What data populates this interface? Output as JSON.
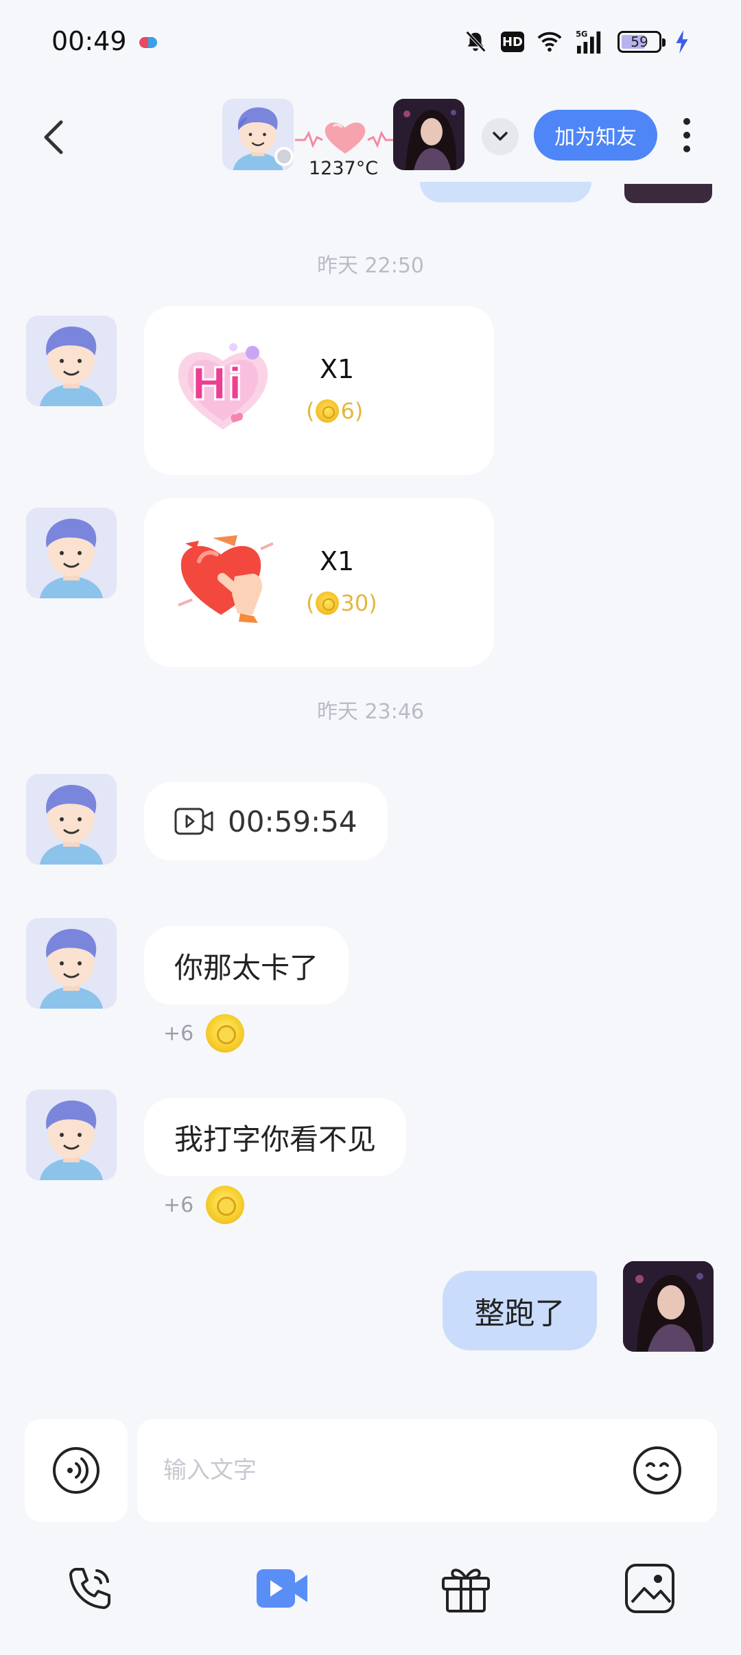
{
  "status_bar": {
    "time": "00:49",
    "battery": "59",
    "network": "5G",
    "hd_badge": "HD"
  },
  "header": {
    "intimacy_temperature": "1237°C",
    "add_friend_label": "加为知友"
  },
  "messages": {
    "timestamp_1": "昨天 22:50",
    "gift_1": {
      "count": "X1",
      "price_open": "(",
      "price_value": "6)",
      "gift": "hi-heart-sticker"
    },
    "gift_2": {
      "count": "X1",
      "price_open": "(",
      "price_value": "30)",
      "gift": "poke-heart-sticker"
    },
    "timestamp_2": "昨天 23:46",
    "video_call_duration": "00:59:54",
    "text_1": "你那太卡了",
    "reward_1": "+6",
    "text_2": "我打字你看不见",
    "reward_2": "+6",
    "my_text_1": "整跑了"
  },
  "input": {
    "placeholder": "输入文字"
  },
  "toolbar": {
    "items": [
      "phone-call",
      "video-call",
      "gift",
      "image"
    ]
  },
  "colors": {
    "accent": "#4e86f7",
    "my_bubble": "#c9dcfb",
    "coin": "#f5c32c",
    "background": "#f6f7fb"
  }
}
